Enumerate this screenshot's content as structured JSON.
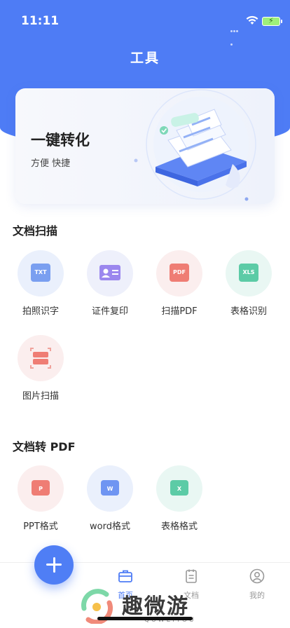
{
  "status_bar": {
    "time": "11:11"
  },
  "header": {
    "title": "工具"
  },
  "banner": {
    "title": "一键转化",
    "subtitle": "方便 快捷"
  },
  "sections": [
    {
      "title": "文档扫描",
      "items": [
        {
          "label": "拍照识字",
          "badge": "TXT",
          "icon": "txt-scan-icon",
          "bg": "#eaf0fc",
          "color": "#7a9ff0"
        },
        {
          "label": "证件复印",
          "badge": "",
          "icon": "id-card-icon",
          "bg": "#eef0fb",
          "color": "#9b87ee"
        },
        {
          "label": "扫描PDF",
          "badge": "PDF",
          "icon": "pdf-scan-icon",
          "bg": "#fbeeee",
          "color": "#ef7d74"
        },
        {
          "label": "表格识别",
          "badge": "XLS",
          "icon": "xls-scan-icon",
          "bg": "#e9f7f3",
          "color": "#5ccba6"
        },
        {
          "label": "图片扫描",
          "badge": "",
          "icon": "image-scan-icon",
          "bg": "#fbeeee",
          "color": "#ef7d74"
        }
      ]
    },
    {
      "title": "文档转 PDF",
      "items": [
        {
          "label": "PPT格式",
          "badge": "P",
          "icon": "ppt-icon",
          "bg": "#fbeeee",
          "color": "#ef7d74"
        },
        {
          "label": "word格式",
          "badge": "W",
          "icon": "word-icon",
          "bg": "#eaf0fc",
          "color": "#6f95f2"
        },
        {
          "label": "表格格式",
          "badge": "X",
          "icon": "excel-icon",
          "bg": "#e9f7f3",
          "color": "#5ccba6"
        }
      ]
    }
  ],
  "tabbar": {
    "tabs": [
      {
        "label": "首页",
        "icon": "briefcase-icon",
        "active": true
      },
      {
        "label": "文档",
        "icon": "document-icon",
        "active": false
      },
      {
        "label": "我的",
        "icon": "user-icon",
        "active": false
      }
    ]
  },
  "watermark": {
    "text": "趣微游",
    "sub": "QUWEIYOU"
  },
  "colors": {
    "accent": "#4e7cf5",
    "active_tab": "#4e7cf5",
    "inactive_tab": "#999999"
  }
}
